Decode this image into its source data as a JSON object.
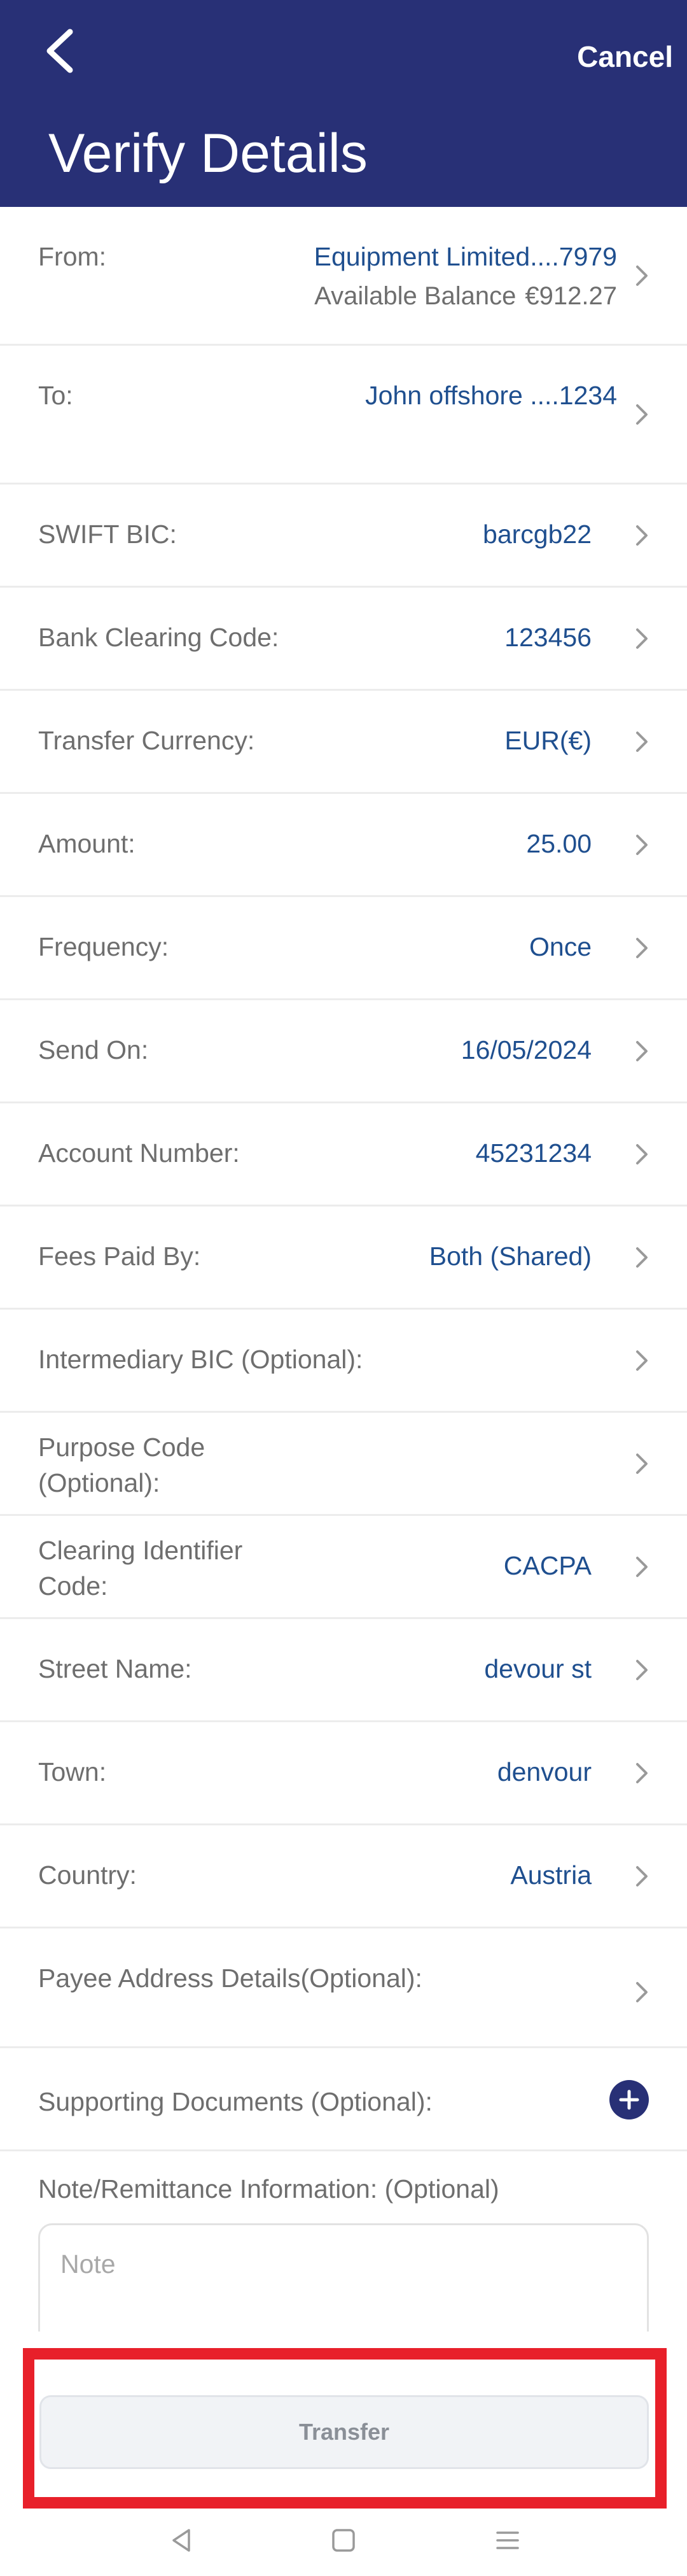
{
  "header": {
    "title": "Verify Details",
    "cancel_label": "Cancel",
    "back_icon": "chevron-left-icon",
    "color": "#283076"
  },
  "rows": [
    {
      "label": "From:",
      "value": "Equipment Limited....7979",
      "sub_label": "Available Balance",
      "sub_value": "€912.27"
    },
    {
      "label": "To:",
      "value": "John offshore ....1234"
    },
    {
      "label": "SWIFT BIC:",
      "value": "barcgb22"
    },
    {
      "label": "Bank Clearing Code:",
      "value": "123456"
    },
    {
      "label": "Transfer Currency:",
      "value": "EUR(€)"
    },
    {
      "label": "Amount:",
      "value": "25.00"
    },
    {
      "label": "Frequency:",
      "value": "Once"
    },
    {
      "label": "Send On:",
      "value": "16/05/2024"
    },
    {
      "label": "Account Number:",
      "value": "45231234"
    },
    {
      "label": "Fees Paid By:",
      "value": "Both (Shared)"
    },
    {
      "label": "Intermediary BIC (Optional):",
      "value": ""
    },
    {
      "label": "Purpose Code (Optional):",
      "value": ""
    },
    {
      "label": "Clearing Identifier Code:",
      "value": "CACPA"
    },
    {
      "label": "Street Name:",
      "value": "devour st"
    },
    {
      "label": "Town:",
      "value": "denvour"
    },
    {
      "label": "Country:",
      "value": "Austria"
    },
    {
      "label": "Payee Address Details(Optional):",
      "value": ""
    },
    {
      "label": "Supporting Documents (Optional):",
      "value": ""
    }
  ],
  "note": {
    "label": "Note/Remittance Information: (Optional)",
    "placeholder": "Note",
    "value": ""
  },
  "transfer_label": "Transfer",
  "colors": {
    "value_text": "#1f4f8f",
    "highlight": "#e8202a",
    "button_bg": "#f1f3f6"
  },
  "nav": {
    "back_icon": "triangle-back-icon",
    "home_icon": "square-home-icon",
    "menu_icon": "menu-lines-icon"
  }
}
